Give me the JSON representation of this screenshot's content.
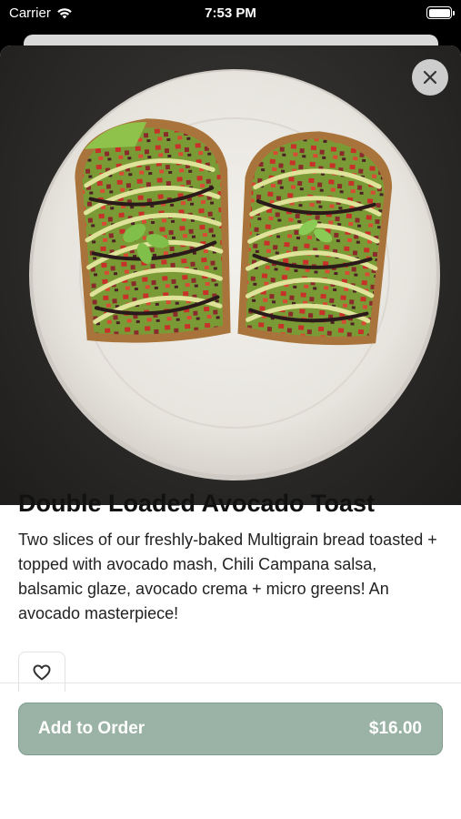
{
  "status_bar": {
    "carrier": "Carrier",
    "time": "7:53 PM",
    "wifi_icon": "wifi-icon",
    "battery_icon": "battery-icon"
  },
  "hero_image": {
    "subject": "avocado-toast-photo"
  },
  "close_icon": "close-icon",
  "item": {
    "title": "Double Loaded Avocado Toast",
    "description": "Two slices of our freshly-baked Multigrain bread toasted + topped with avocado mash, Chili Campana salsa, balsamic glaze, avocado crema + micro greens! An avocado masterpiece!"
  },
  "favorite_icon": "heart-icon",
  "order_button": {
    "label": "Add to Order",
    "price": "$16.00"
  },
  "colors": {
    "accent": "#9ab3a6",
    "accent_border": "#7f9b8c"
  }
}
